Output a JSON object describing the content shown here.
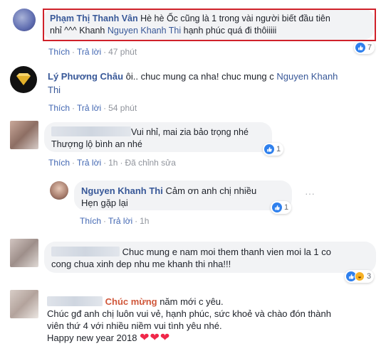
{
  "comments": [
    {
      "name": "Phạm Thị Thanh Vân",
      "text_line1": "Hè hè Ốc cũng là 1 trong vài người biết đầu tiên",
      "text_line2_pre": "nhỉ ^^^ Khanh ",
      "mention": "Nguyen Khanh Thi",
      "text_line2_post": " hạnh phúc quá đi thôiiiii",
      "like": "Thích",
      "reply": "Trả lời",
      "time": "47 phút",
      "reaction_count": "7"
    },
    {
      "name": "Lý Phương Châu",
      "text_pre": " ôi.. chuc mung ca nha! chuc mung c ",
      "mention_line1": "Nguyen Khanh",
      "mention_line2": "Thi",
      "like": "Thích",
      "reply": "Trả lời",
      "time": "54 phút"
    },
    {
      "text_line1": "Vui nhỉ, mai zia bảo trọng nhé",
      "text_line2": "Thượng lộ bình an nhé",
      "like": "Thích",
      "reply": "Trả lời",
      "time": "1h",
      "edited": "Đã chỉnh sửa",
      "reaction_count": "1"
    },
    {
      "name": "Nguyen Khanh Thi",
      "text_line1": "Cảm ơn anh chị nhiều",
      "text_line2": "Hẹn gặp lại",
      "like": "Thích",
      "reply": "Trả lời",
      "time": "1h",
      "reaction_count": "1"
    },
    {
      "text_line1": "Chuc mung e nam moi them thanh vien moi la 1 co",
      "text_line2": "cong chua xinh dep nhu me khanh thi nha!!!",
      "reaction_count": "3"
    },
    {
      "name_highlight": "Chúc mừng",
      "text_line1_post": " năm mới c yêu.",
      "text_line2": "Chúc gđ anh chị luôn vui vẻ, hạnh phúc, sức khoẻ và chào đón thành",
      "text_line3": "viên thứ 4 với nhiều niềm vui tình yêu nhé.",
      "text_line4": "Happy new year 2018",
      "hearts": "❤❤❤"
    }
  ],
  "separator": "·",
  "more_icon": "···",
  "colors": {
    "link": "#385898",
    "action": "#4267b2",
    "highlight_border": "#d0212a",
    "bubble": "#f2f3f5"
  }
}
